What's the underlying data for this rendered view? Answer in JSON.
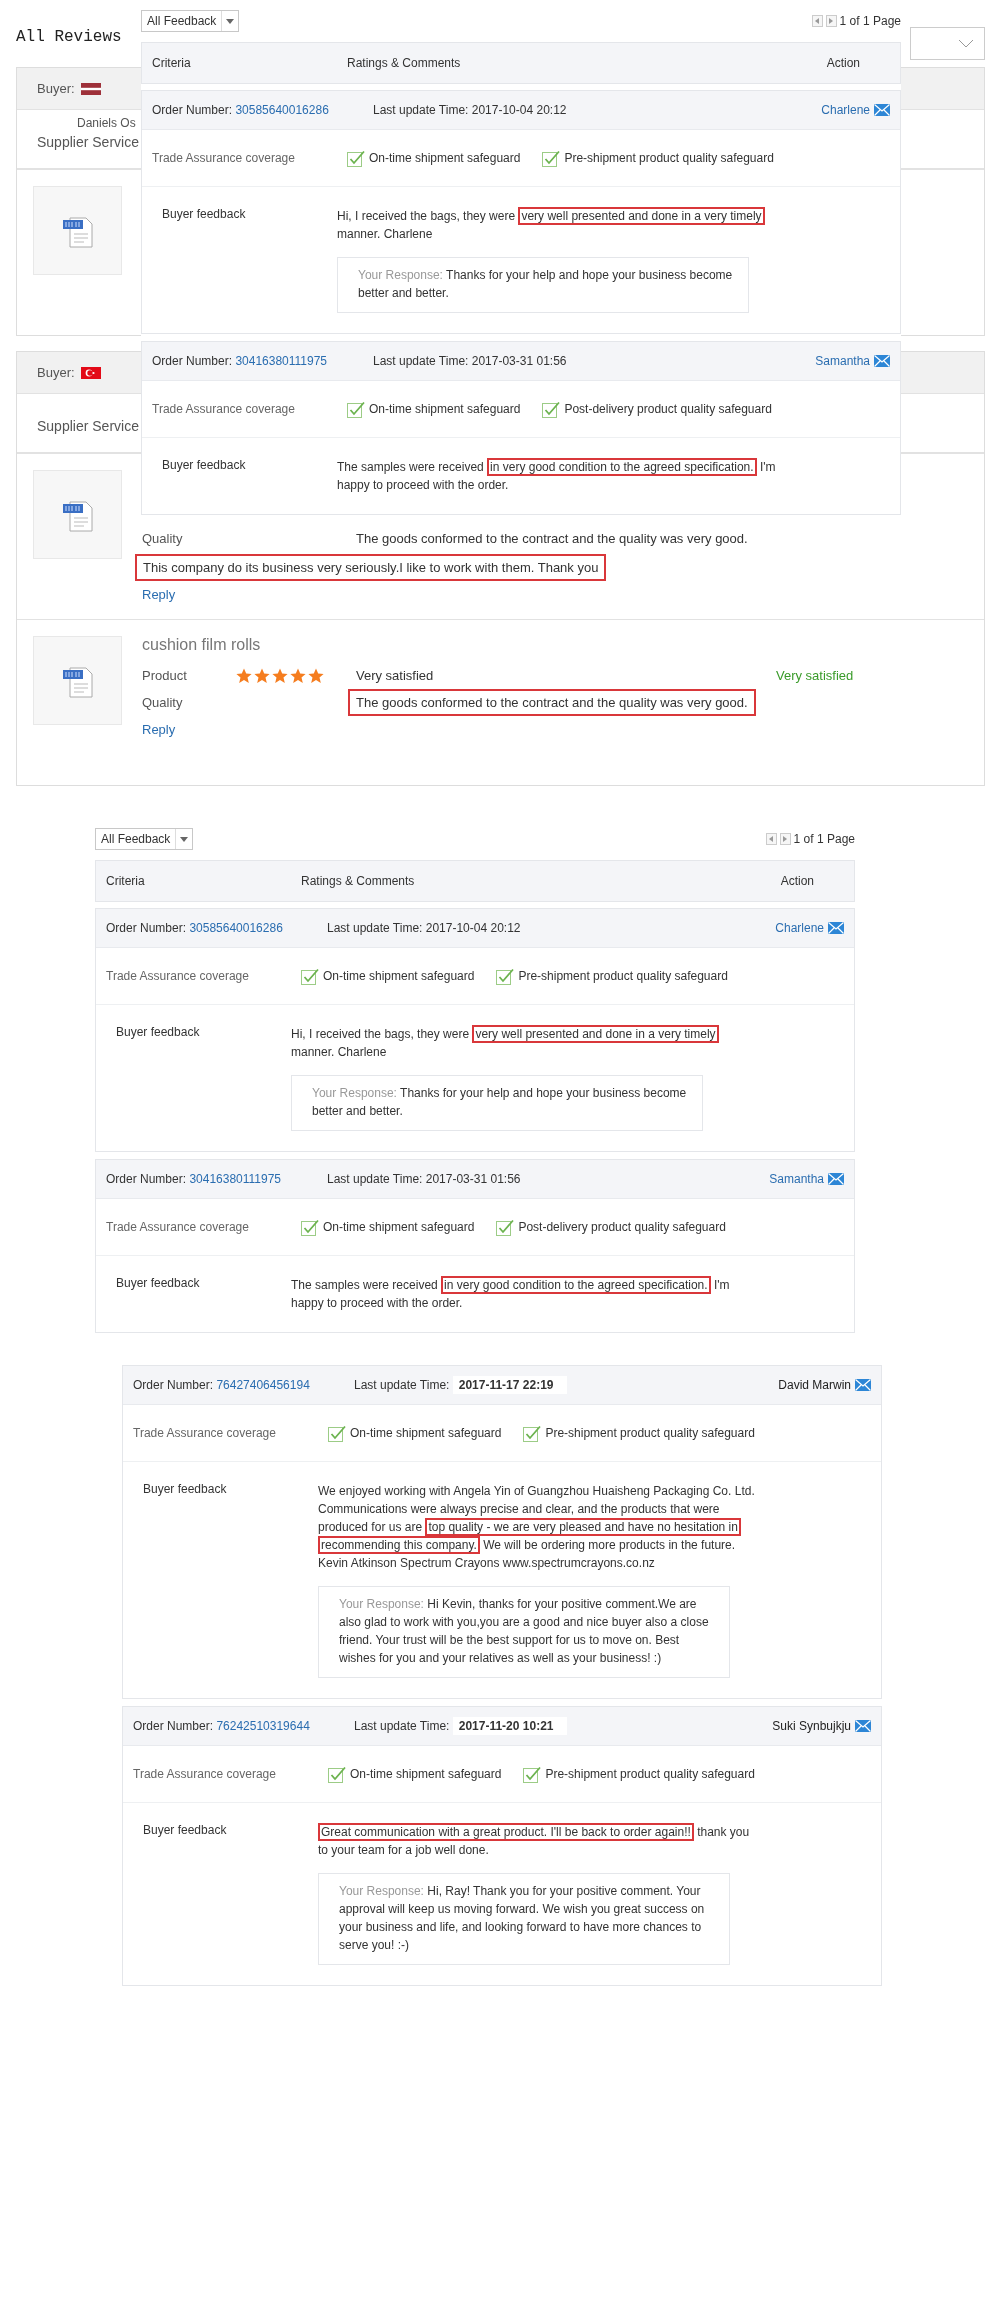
{
  "reviews_page": {
    "title": "All Reviews",
    "reviews": [
      {
        "buyer_label": "Buyer:",
        "buyer_name": "Daniels Os",
        "service_label": "Supplier Service"
      },
      {
        "buyer_label": "Buyer:",
        "service_label": "Supplier Service",
        "items": [
          {
            "criteria": [
              {
                "label": "Quality",
                "comment": "The goods conformed to the contract and the quality was very good.",
                "highlighted": false
              }
            ],
            "comment": "This company do its business very seriously.I like to work with them. Thank you",
            "comment_highlighted": true,
            "reply": "Reply"
          },
          {
            "product": "cushion film rolls",
            "criteria": [
              {
                "label": "Product",
                "stars": 5,
                "comment": "Very satisfied",
                "verdict": "Very satisfied",
                "highlighted": false
              },
              {
                "label": "Quality",
                "comment": "The goods conformed to the contract and the quality was very good.",
                "highlighted": true
              }
            ],
            "reply": "Reply"
          }
        ]
      }
    ]
  },
  "overlay_panel": {
    "filter": "All Feedback",
    "pager": "1 of 1 Page",
    "columns": [
      "Criteria",
      "Ratings & Comments",
      "Action"
    ],
    "orders": [
      {
        "order_label": "Order Number:",
        "order_number": "30585640016286",
        "time_label": "Last update Time:",
        "time": "2017-10-04 20:12",
        "time_emphasized": false,
        "buyer": "Charlene",
        "coverage_label": "Trade Assurance coverage",
        "coverage": [
          {
            "label": "On-time shipment safeguard",
            "checked": true
          },
          {
            "label": "Pre-shipment product quality safeguard",
            "checked": true
          }
        ],
        "feedback_label": "Buyer feedback",
        "feedback": [
          {
            "text": "Hi, I received the bags, they were ",
            "highlighted": false
          },
          {
            "text": "very well presented and done in a very timely",
            "highlighted": true
          },
          {
            "text": " manner. Charlene",
            "highlighted": false
          }
        ],
        "response_label": "Your Response:",
        "response": "Thanks for your help and hope your business become better and better."
      },
      {
        "order_label": "Order Number:",
        "order_number": "30416380111975",
        "time_label": "Last update Time:",
        "time": "2017-03-31 01:56",
        "time_emphasized": false,
        "buyer": "Samantha",
        "coverage_label": "Trade Assurance coverage",
        "coverage": [
          {
            "label": "On-time shipment safeguard",
            "checked": true
          },
          {
            "label": "Post-delivery product quality safeguard",
            "checked": true
          }
        ],
        "feedback_label": "Buyer feedback",
        "feedback": [
          {
            "text": "The samples were received ",
            "highlighted": false
          },
          {
            "text": "in very good condition to the agreed specification.",
            "highlighted": true
          },
          {
            "text": " I'm happy to proceed with the order.",
            "highlighted": false
          }
        ]
      }
    ]
  },
  "feedback_panel": {
    "filter": "All Feedback",
    "pager": "1 of 1 Page",
    "columns": [
      "Criteria",
      "Ratings & Comments",
      "Action"
    ],
    "orders": [
      {
        "order_label": "Order Number:",
        "order_number": "30585640016286",
        "time_label": "Last update Time:",
        "time": "2017-10-04 20:12",
        "time_emphasized": false,
        "buyer": "Charlene",
        "coverage_label": "Trade Assurance coverage",
        "coverage": [
          {
            "label": "On-time shipment safeguard",
            "checked": true
          },
          {
            "label": "Pre-shipment product quality safeguard",
            "checked": true
          }
        ],
        "feedback_label": "Buyer feedback",
        "feedback": [
          {
            "text": "Hi, I received the bags, they were ",
            "highlighted": false
          },
          {
            "text": "very well presented and done in a very timely",
            "highlighted": true
          },
          {
            "text": " manner. Charlene",
            "highlighted": false
          }
        ],
        "response_label": "Your Response:",
        "response": "Thanks for your help and hope your business become better and better."
      },
      {
        "order_label": "Order Number:",
        "order_number": "30416380111975",
        "time_label": "Last update Time:",
        "time": "2017-03-31 01:56",
        "time_emphasized": false,
        "buyer": "Samantha",
        "coverage_label": "Trade Assurance coverage",
        "coverage": [
          {
            "label": "On-time shipment safeguard",
            "checked": true
          },
          {
            "label": "Post-delivery product quality safeguard",
            "checked": true
          }
        ],
        "feedback_label": "Buyer feedback",
        "feedback": [
          {
            "text": "The samples were received ",
            "highlighted": false
          },
          {
            "text": "in very good condition to the agreed specification.",
            "highlighted": true
          },
          {
            "text": " I'm happy to proceed with the order.",
            "highlighted": false
          }
        ]
      }
    ]
  },
  "feedback_panel_2": {
    "orders": [
      {
        "order_label": "Order Number:",
        "order_number": "76427406456194",
        "time_label": "Last update Time:",
        "time": "2017-11-17 22:19",
        "time_emphasized": true,
        "buyer": "David Marwin",
        "coverage_label": "Trade Assurance coverage",
        "coverage": [
          {
            "label": "On-time shipment safeguard",
            "checked": true
          },
          {
            "label": "Pre-shipment product quality safeguard",
            "checked": true
          }
        ],
        "feedback_label": "Buyer feedback",
        "feedback": [
          {
            "text": "We enjoyed working with Angela Yin of Guangzhou Huaisheng Packaging Co. Ltd. Communications were always precise and clear, and the products that were produced for us are ",
            "highlighted": false
          },
          {
            "text": "top quality - we are very pleased and have no hesitation in recommending this company.",
            "highlighted": true
          },
          {
            "text": " We will be ordering more products in the future. Kevin Atkinson Spectrum Crayons www.spectrumcrayons.co.nz",
            "highlighted": false
          }
        ],
        "response_label": "Your Response:",
        "response": "Hi Kevin, thanks for your positive comment.We are also glad to work with you,you are a good and nice buyer also a close friend. Your trust will be the best support for us to move on. Best wishes for you and your relatives as well as your business! :)"
      },
      {
        "order_label": "Order Number:",
        "order_number": "76242510319644",
        "time_label": "Last update Time:",
        "time": "2017-11-20 10:21",
        "time_emphasized": true,
        "buyer": "Suki Synbujkju",
        "coverage_label": "Trade Assurance coverage",
        "coverage": [
          {
            "label": "On-time shipment safeguard",
            "checked": true
          },
          {
            "label": "Pre-shipment product quality safeguard",
            "checked": true
          }
        ],
        "feedback_label": "Buyer feedback",
        "feedback": [
          {
            "text": "Great communication with a great product. I'll be back to order again!!",
            "highlighted": true
          },
          {
            "text": " thank you to your team for a job well done.",
            "highlighted": false
          }
        ],
        "response_label": "Your Response:",
        "response": "Hi, Ray! Thank you for your positive comment. Your approval will keep us moving forward. We wish you great success on your business and life, and looking forward to have more chances to serve you! :-)"
      }
    ]
  }
}
